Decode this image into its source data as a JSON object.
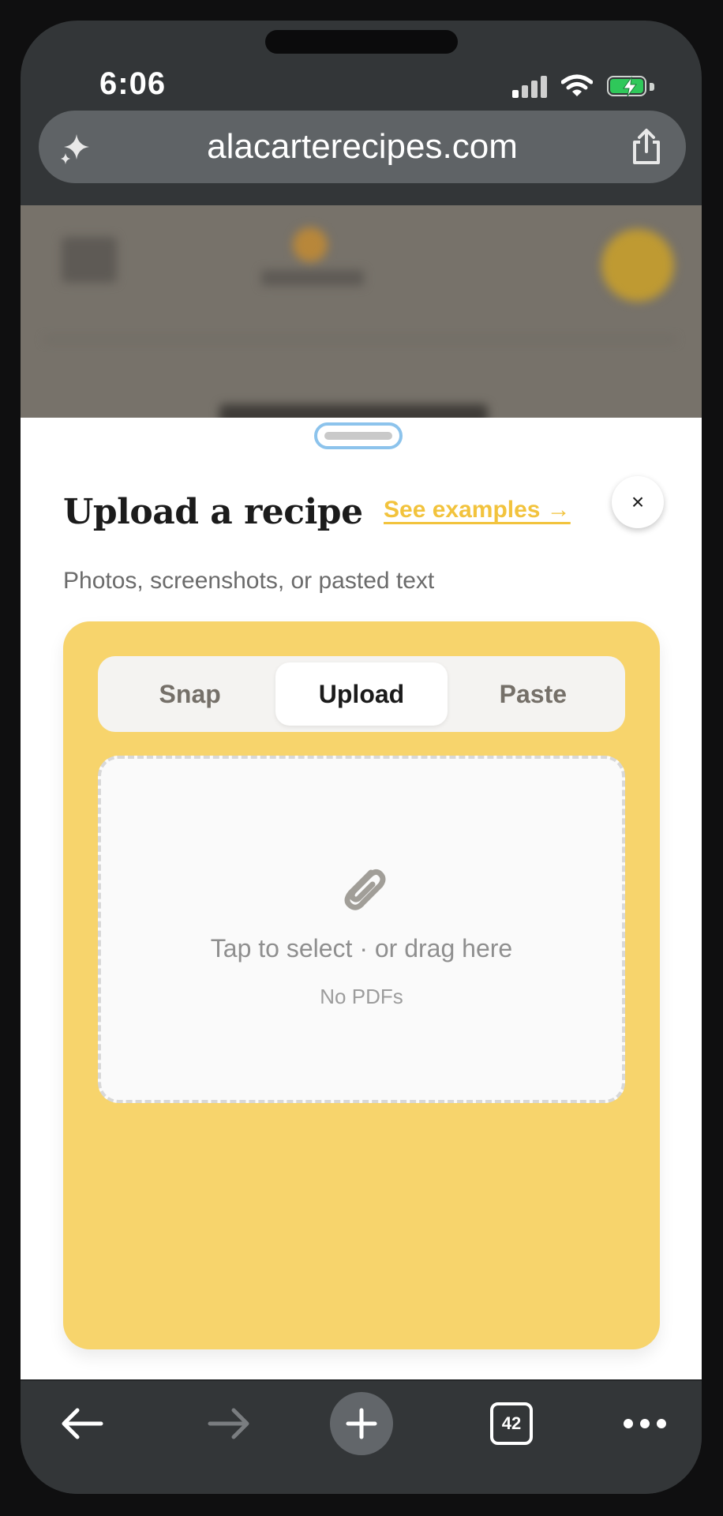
{
  "status_bar": {
    "time": "6:06"
  },
  "browser": {
    "url": "alacarterecipes.com",
    "tab_count": "42"
  },
  "sheet": {
    "title": "Upload a recipe",
    "examples_link": "See examples →",
    "close_label": "×",
    "subtitle": "Photos, screenshots, or pasted text",
    "tabs": [
      {
        "label": "Snap",
        "active": false
      },
      {
        "label": "Upload",
        "active": true
      },
      {
        "label": "Paste",
        "active": false
      }
    ],
    "dropzone": {
      "primary": "Tap to select · or drag here",
      "note": "No PDFs"
    }
  },
  "colors": {
    "panel": "#f7d46c",
    "accent_link": "#f2c33d",
    "battery_fill": "#2fc85a",
    "grabber_focus": "#8cc3ec"
  },
  "icons": {
    "url_left": "sparkle-icon",
    "url_right": "share-icon",
    "dropzone": "paperclip-icon",
    "toolbar": [
      "back-arrow-icon",
      "forward-arrow-icon",
      "plus-icon",
      "tabs-icon",
      "more-icon"
    ]
  }
}
